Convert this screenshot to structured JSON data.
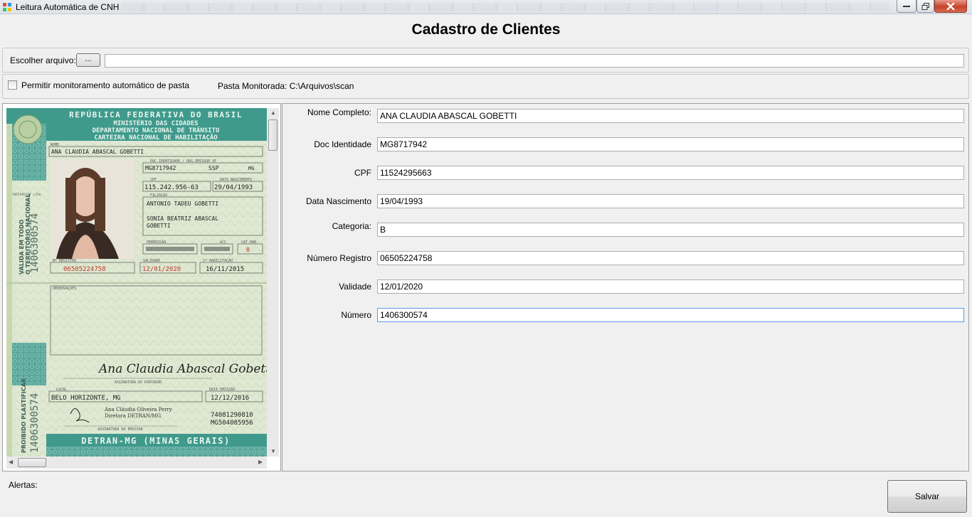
{
  "window": {
    "title": "Leitura Automática de CNH",
    "icon": "app-icon"
  },
  "header": {
    "title": "Cadastro de Clientes"
  },
  "file_chooser": {
    "label": "Escolher arquivo:",
    "browse_label": "...",
    "path_value": ""
  },
  "monitor": {
    "checkbox_label": "Permitir monitoramento automático de pasta",
    "checked": false,
    "folder_text": "Pasta Monitorada: C:\\Arquivos\\scan"
  },
  "cnh": {
    "header_lines": [
      "REPÚBLICA FEDERATIVA DO BRASIL",
      "MINISTÉRIO DAS CIDADES",
      "DEPARTAMENTO NACIONAL DE TRÂNSITO",
      "CARTEIRA NACIONAL DE HABILITAÇÃO"
    ],
    "nome_label": "NOME",
    "nome": "ANA CLAUDIA ABASCAL GOBETTI",
    "doc_label": "DOC.IDENTIDADE / ORG.EMISSOR UF",
    "doc": "MG8717942",
    "doc_org": "SSP",
    "doc_uf": "MG",
    "cpf_label": "CPF",
    "cpf": "115.242.956-63",
    "nasc_label": "DATA NASCIMENTO",
    "nasc": "29/04/1993",
    "filiacao_label": "FILIAÇÃO",
    "filiacao": [
      "ANTONIO TADEU GOBETTI",
      "SONIA BEATRIZ ABASCAL",
      "GOBETTI"
    ],
    "permissao_label": "PERMISSÃO",
    "acc_label": "ACC",
    "cat_label": "CAT.HAB.",
    "cat": "B",
    "registro_label": "Nº REGISTRO",
    "registro": "06505224758",
    "validade_label": "VALIDADE",
    "validade": "12/01/2020",
    "hab_label": "1ª HABILITAÇÃO",
    "hab": "16/11/2015",
    "side_number": "1406300574",
    "side_text_1": "VÁLIDA EM TODO",
    "side_text_2": "O TERRITÓRIO NACIONAL",
    "side_text_3": "PROIBIDO PLASTIFICAR",
    "interprint": "INTERPRINT LTDA",
    "obs_label": "OBSERVAÇÕES",
    "signature": "Ana Claudia Abascal Gobetti",
    "assinatura_label": "ASSINATURA DO PORTADOR",
    "local_label": "LOCAL",
    "local": "BELO HORIZONTE, MG",
    "emissao_label": "DATA EMISSÃO",
    "emissao": "12/12/2016",
    "diretor_nome": "Ana Cláudia Oliveira Perry",
    "diretor_cargo": "Diretora DETRAN/MG",
    "codigo_1": "74081290810",
    "codigo_2": "MG504085956",
    "emissor_label": "ASSINATURA DO EMISSOR",
    "footer": "DETRAN-MG (MINAS GERAIS)"
  },
  "form": {
    "fields": [
      {
        "label": "Nome Completo:",
        "value": "ANA CLAUDIA ABASCAL GOBETTI"
      },
      {
        "label": "Doc Identidade",
        "value": "MG8717942"
      },
      {
        "label": "CPF",
        "value": "11524295663"
      },
      {
        "label": "Data Nascimento",
        "value": "19/04/1993"
      },
      {
        "label": "Categoria:",
        "value": "B"
      },
      {
        "label": "Número Registro",
        "value": "06505224758"
      },
      {
        "label": "Validade",
        "value": "12/01/2020"
      },
      {
        "label": "Número",
        "value": "1406300574"
      }
    ]
  },
  "footer": {
    "alerts_label": "Alertas:",
    "save_label": "Salvar"
  },
  "colors": {
    "card_green": "#dfe8d2",
    "card_header": "#3f9a8c",
    "card_red": "#c0392b"
  }
}
